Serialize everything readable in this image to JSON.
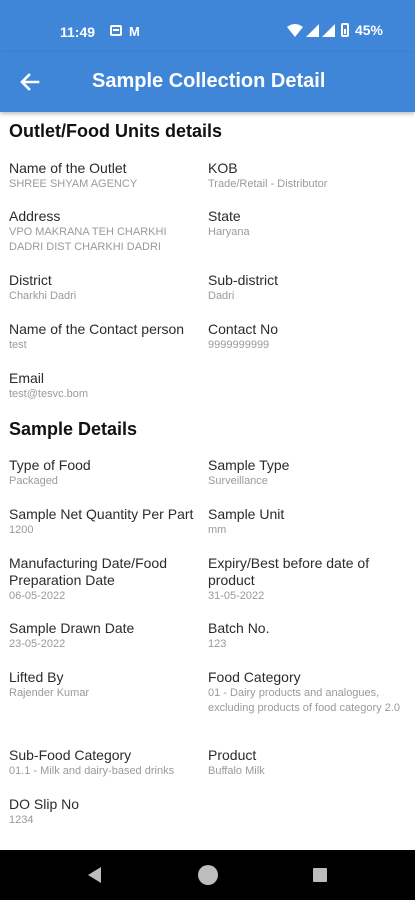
{
  "status_bar": {
    "time": "11:49",
    "mail_glyph": "M",
    "battery": "45%"
  },
  "app_bar": {
    "title": "Sample Collection Detail"
  },
  "outlet_section": {
    "title": "Outlet/Food Units details",
    "fields": [
      {
        "label": "Name of the Outlet",
        "value": "SHREE SHYAM AGENCY"
      },
      {
        "label": "KOB",
        "value": "Trade/Retail - Distributor"
      },
      {
        "label": "Address",
        "value": "VPO MAKRANA TEH CHARKHI DADRI DIST CHARKHI DADRI"
      },
      {
        "label": "State",
        "value": "Haryana"
      },
      {
        "label": "District",
        "value": "Charkhi Dadri"
      },
      {
        "label": "Sub-district",
        "value": "Dadri"
      },
      {
        "label": "Name of the Contact person",
        "value": "test"
      },
      {
        "label": "Contact No",
        "value": "9999999999"
      },
      {
        "label": "Email",
        "value": "test@tesvc.bom"
      }
    ]
  },
  "sample_section": {
    "title": "Sample Details",
    "fields": [
      {
        "label": "Type of Food",
        "value": "Packaged"
      },
      {
        "label": "Sample Type",
        "value": "Surveillance"
      },
      {
        "label": "Sample Net Quantity Per Part",
        "value": "1200"
      },
      {
        "label": "Sample Unit",
        "value": "mm"
      },
      {
        "label": "Manufacturing Date/Food Preparation Date",
        "value": "06-05-2022"
      },
      {
        "label": "Expiry/Best before date of product",
        "value": "31-05-2022"
      },
      {
        "label": "Sample Drawn Date",
        "value": "23-05-2022"
      },
      {
        "label": "Batch No.",
        "value": "123"
      },
      {
        "label": "Lifted By",
        "value": "Rajender Kumar"
      },
      {
        "label": "Food Category",
        "value": "01 - Dairy products and analogues, excluding products of food category 2.0"
      },
      {
        "label": "Sub-Food Category",
        "value": "01.1 - Milk and dairy-based drinks"
      },
      {
        "label": "Product",
        "value": "Buffalo Milk"
      },
      {
        "label": "DO Slip No",
        "value": "1234"
      }
    ]
  }
}
